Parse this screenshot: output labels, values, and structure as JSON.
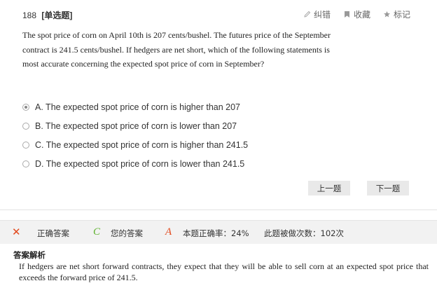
{
  "question": {
    "number": "188",
    "type": "[单选题]",
    "stem": "The spot price of corn on April 10th is 207 cents/bushel. The futures price of the September contract is 241.5 cents/bushel. If hedgers are net short, which of the following statements is most accurate concerning the expected spot price of corn in September?"
  },
  "actions": {
    "report_label": "纠错",
    "favorite_label": "收藏",
    "mark_label": "标记"
  },
  "options": [
    {
      "label": "A. The expected spot price of corn is higher than 207",
      "selected": true
    },
    {
      "label": "B. The expected spot price of corn is lower than 207",
      "selected": false
    },
    {
      "label": "C. The expected spot price of corn is higher than 241.5",
      "selected": false
    },
    {
      "label": "D. The expected spot price of corn is lower than 241.5",
      "selected": false
    }
  ],
  "nav": {
    "prev_label": "上一题",
    "next_label": "下一题"
  },
  "result": {
    "wrong_mark": "✕",
    "correct_answer_label": "正确答案",
    "correct_answer_value": "C",
    "your_answer_label": "您的答案",
    "your_answer_value": "A",
    "accuracy": "本题正确率：24%",
    "attempts": "此题被做次数：102次",
    "colors": {
      "wrong": "#e2491d",
      "correct": "#5fb22f"
    }
  },
  "analysis": {
    "title": "答案解析",
    "body": "If hedgers are net short forward contracts, they expect that they will be able to sell corn at an expected spot price that exceeds the forward price of 241.5."
  }
}
